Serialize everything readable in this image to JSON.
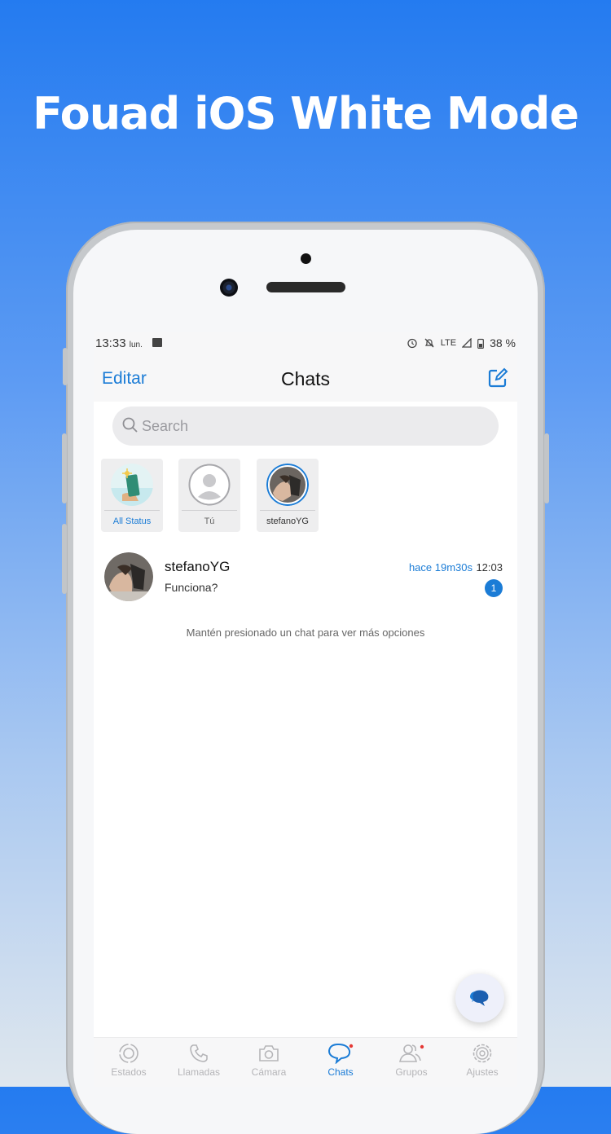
{
  "banner": {
    "title": "Fouad iOS White Mode"
  },
  "statusbar": {
    "time": "13:33",
    "day": "lun.",
    "network": "LTE",
    "battery": "38 %"
  },
  "navbar": {
    "edit_label": "Editar",
    "title": "Chats",
    "compose_icon": "compose-icon"
  },
  "search": {
    "placeholder": "Search"
  },
  "statuses": [
    {
      "label": "All Status"
    },
    {
      "label": "Tú"
    },
    {
      "label": "stefanoYG"
    }
  ],
  "chats": [
    {
      "name": "stefanoYG",
      "message": "Funciona?",
      "ago": "hace 19m30s",
      "time": "12:03",
      "unread": "1"
    }
  ],
  "hint": "Mantén presionado un chat para ver más opciones",
  "tabs": [
    {
      "label": "Estados",
      "icon": "status-icon"
    },
    {
      "label": "Llamadas",
      "icon": "phone-icon"
    },
    {
      "label": "Cámara",
      "icon": "camera-icon"
    },
    {
      "label": "Chats",
      "icon": "chats-icon"
    },
    {
      "label": "Grupos",
      "icon": "groups-icon"
    },
    {
      "label": "Ajustes",
      "icon": "settings-icon"
    }
  ],
  "colors": {
    "accent": "#1b7cd6",
    "background_top": "#247bf0"
  }
}
